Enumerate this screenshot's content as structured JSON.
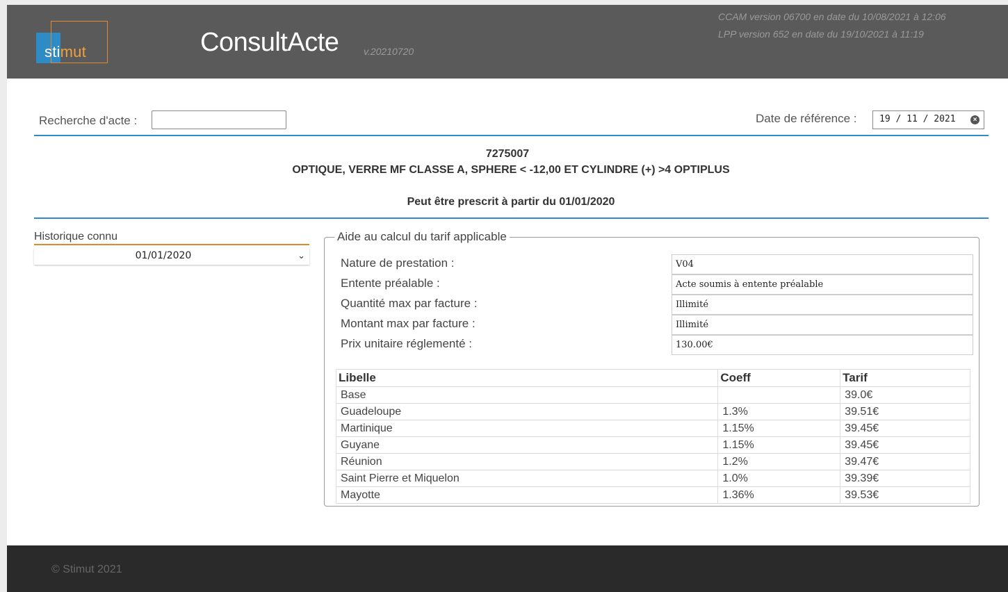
{
  "header": {
    "logo_part1": "sti",
    "logo_part2": "mut",
    "app_title": "ConsultActe",
    "app_version": "v.20210720",
    "ccam_version": "CCAM version 06700 en date du 10/08/2021 à 12:06",
    "lpp_version": "LPP version 652 en date du 19/10/2021 à 11:19"
  },
  "search": {
    "label": "Recherche d'acte :",
    "value": ""
  },
  "reference_date": {
    "label": "Date de référence :",
    "value": "19 / 11 / 2021"
  },
  "act": {
    "code": "7275007",
    "label": "OPTIQUE, VERRE MF CLASSE A, SPHERE < -12,00 ET CYLINDRE (+) >4 OPTIPLUS",
    "prescribable": "Peut être prescrit à partir du 01/01/2020"
  },
  "history": {
    "label": "Historique connu",
    "selected": "01/01/2020"
  },
  "calc": {
    "legend": "Aide au calcul du tarif applicable",
    "fields": [
      {
        "label": "Nature de prestation :",
        "value": "V04"
      },
      {
        "label": "Entente préalable :",
        "value": "Acte soumis à entente préalable"
      },
      {
        "label": "Quantité max par facture :",
        "value": "Illimité"
      },
      {
        "label": "Montant max par facture :",
        "value": "Illimité"
      },
      {
        "label": "Prix unitaire réglementé :",
        "value": "130.00€"
      }
    ],
    "table": {
      "headers": [
        "Libelle",
        "Coeff",
        "Tarif"
      ],
      "rows": [
        [
          "Base",
          "",
          "39.0€"
        ],
        [
          "Guadeloupe",
          "1.3%",
          "39.51€"
        ],
        [
          "Martinique",
          "1.15%",
          "39.45€"
        ],
        [
          "Guyane",
          "1.15%",
          "39.45€"
        ],
        [
          "Réunion",
          "1.2%",
          "39.47€"
        ],
        [
          "Saint Pierre et Miquelon",
          "1.0%",
          "39.39€"
        ],
        [
          "Mayotte",
          "1.36%",
          "39.53€"
        ]
      ]
    }
  },
  "footer": {
    "copyright": "© Stimut 2021"
  }
}
